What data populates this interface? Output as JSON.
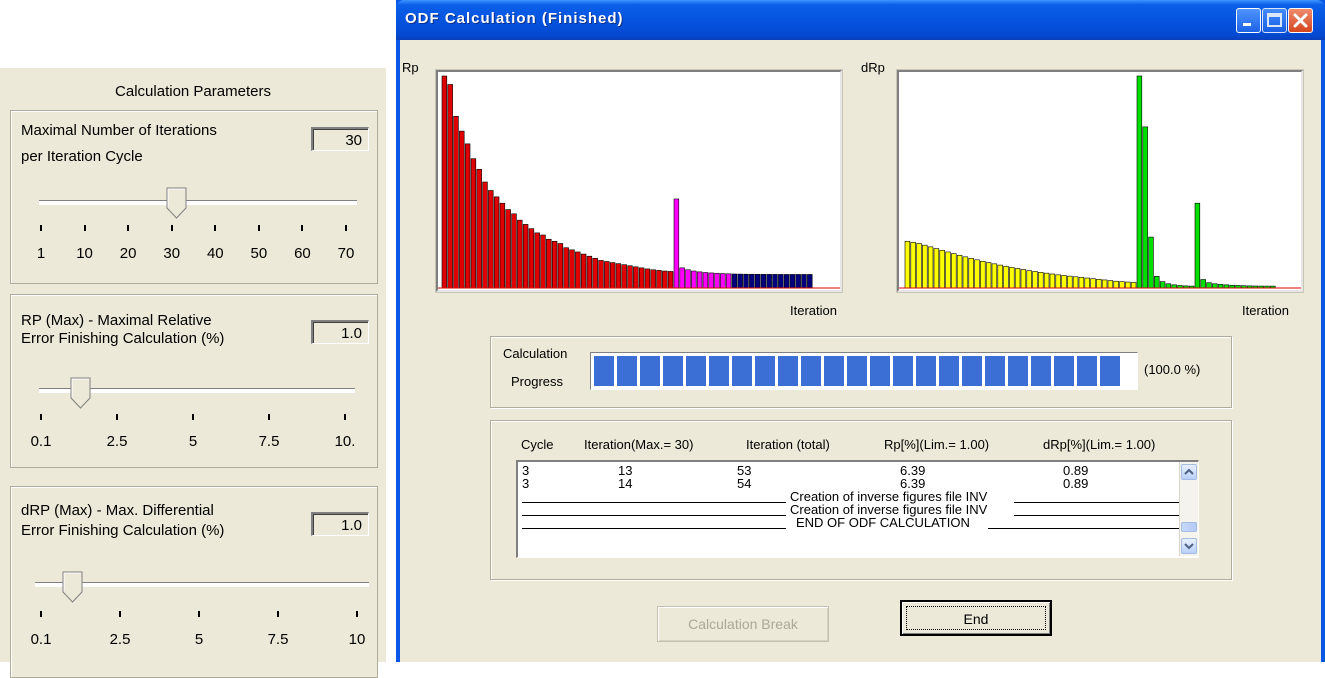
{
  "left_panel": {
    "title": "Calculation Parameters",
    "iterations": {
      "label_line1": "Maximal Number of  Iterations",
      "label_line2": "per Iteration Cycle",
      "value": "30",
      "scale": [
        "1",
        "10",
        "20",
        "30",
        "40",
        "50",
        "60",
        "70"
      ],
      "slider_value": 30
    },
    "rp_max": {
      "label_line1": "RP (Max)  - Maximal Relative",
      "label_line2": "Error Finishing Calculation (%)",
      "value": "1.0",
      "scale": [
        "0.1",
        "2.5",
        "5",
        "7.5",
        "10."
      ],
      "slider_value": 1.0
    },
    "drp_max": {
      "label_line1": "dRP (Max) - Max. Differential",
      "label_line2": "Error Finishing Calculation (%)",
      "value": "1.0",
      "scale": [
        "0.1",
        "2.5",
        "5",
        "7.5",
        "10"
      ],
      "slider_value": 1.0
    }
  },
  "window": {
    "title": "ODF Calculation (Finished)",
    "rp_chart": {
      "axis_y_label": "Rp",
      "axis_x_label": "Iteration",
      "colors": {
        "cycle1": "#e00000",
        "cycle2": "#ff00ff",
        "cycle3": "#00007f",
        "limit_line": "#e00000"
      }
    },
    "drp_chart": {
      "axis_y_label": "dRp",
      "axis_x_label": "Iteration",
      "colors": {
        "cycle1": "#ffff00",
        "cycle2": "#00e000",
        "cycle3": "#00e000",
        "limit_line": "#e00000"
      }
    },
    "progress": {
      "label_line1": "Calculation",
      "label_line2": "Progress",
      "percent_text": "(100.0 %)",
      "fraction": 1.0,
      "bar_color": "#3c6fd6"
    },
    "log": {
      "headers": [
        "Cycle",
        "Iteration(Max.= 30)",
        "Iteration (total)",
        "Rp[%](Lim.= 1.00)",
        "dRp[%](Lim.= 1.00)"
      ],
      "rows": [
        [
          "3",
          "13",
          "53",
          "6.39",
          "0.89"
        ],
        [
          "3",
          "14",
          "54",
          "6.39",
          "0.89"
        ]
      ],
      "messages": [
        "Creation of inverse figures file INV",
        "Creation of inverse figures file INV",
        "END OF ODF CALCULATION"
      ]
    },
    "buttons": {
      "break": "Calculation Break",
      "end": "End"
    }
  },
  "chart_data": [
    {
      "type": "bar",
      "ylabel": "Rp",
      "xlabel": "Iteration",
      "series": [
        {
          "values": [
            100,
            96,
            81,
            74,
            68,
            61,
            56,
            50,
            46,
            43,
            40,
            37,
            35,
            32,
            30,
            28,
            26,
            25,
            23,
            22,
            21,
            19,
            18,
            17,
            16,
            15,
            14,
            13,
            12.5,
            12,
            11.5,
            11,
            10.5,
            10,
            9.5,
            9,
            8.6,
            8.3,
            8.0,
            7.8
          ]
        },
        {
          "values": [
            42,
            9.5,
            8.6,
            8.0,
            7.6,
            7.3,
            7.1,
            6.9,
            6.8,
            6.7
          ]
        },
        {
          "values": [
            6.6,
            6.55,
            6.5,
            6.47,
            6.45,
            6.43,
            6.42,
            6.41,
            6.4,
            6.39,
            6.39,
            6.39,
            6.39,
            6.39
          ]
        }
      ]
    },
    {
      "type": "bar",
      "ylabel": "dRp",
      "xlabel": "Iteration",
      "series": [
        {
          "values": [
            22,
            21.5,
            21,
            20.2,
            19.4,
            18.6,
            17.8,
            17,
            16.2,
            15.4,
            14.7,
            14,
            13.3,
            12.6,
            12,
            11.4,
            10.8,
            10.2,
            9.7,
            9.2,
            8.7,
            8.2,
            7.8,
            7.4,
            7.0,
            6.6,
            6.2,
            5.9,
            5.6,
            5.3,
            5.0,
            4.7,
            4.4,
            4.1,
            3.8,
            3.5,
            3.2,
            3.0,
            2.8,
            2.6
          ]
        },
        {
          "values": [
            100,
            76,
            24,
            5.5,
            3.0,
            2.0,
            1.5,
            1.2,
            1.0,
            0.9
          ]
        },
        {
          "values": [
            40,
            4.0,
            2.5,
            2.0,
            1.7,
            1.5,
            1.3,
            1.2,
            1.1,
            1.0,
            0.95,
            0.92,
            0.9,
            0.89
          ]
        }
      ]
    }
  ]
}
